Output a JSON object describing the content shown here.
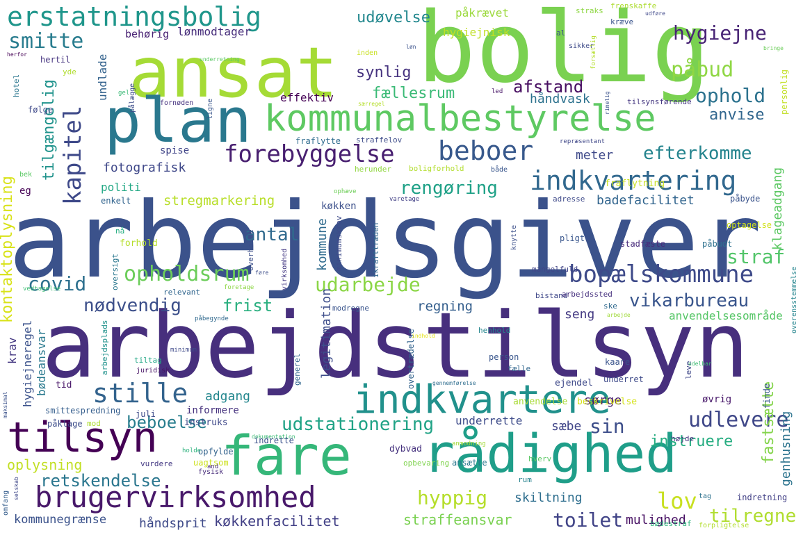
{
  "words": [
    {
      "text": "arbejdsgiver",
      "color": "#3b528b"
    },
    {
      "text": "arbejdstilsyn",
      "color": "#472f7d"
    },
    {
      "text": "bolig",
      "color": "#7ad151"
    },
    {
      "text": "ansat",
      "color": "#a5db36"
    },
    {
      "text": "plan",
      "color": "#2a788e"
    },
    {
      "text": "kommunalbestyrelse",
      "color": "#5ec962"
    },
    {
      "text": "fare",
      "color": "#35b779"
    },
    {
      "text": "rådighed",
      "color": "#1f9e89"
    },
    {
      "text": "tilsyn",
      "color": "#440154"
    },
    {
      "text": "indkvartere",
      "color": "#21918c"
    },
    {
      "text": "brugervirksomhed",
      "color": "#48186a"
    },
    {
      "text": "erstatningsbolig",
      "color": "#1f968b"
    },
    {
      "text": "indkvartering",
      "color": "#31688e"
    },
    {
      "text": "bopælskommune",
      "color": "#3e4a89"
    },
    {
      "text": "forebyggelse",
      "color": "#481f70"
    },
    {
      "text": "beboer",
      "color": "#38598c"
    },
    {
      "text": "stille",
      "color": "#33638d"
    },
    {
      "text": "smitte",
      "color": "#287c8e"
    },
    {
      "text": "kapitel",
      "color": "#3e4989"
    },
    {
      "text": "påbud",
      "color": "#8fd744"
    },
    {
      "text": "hygiejne",
      "color": "#482475"
    },
    {
      "text": "ophold",
      "color": "#2c728e"
    },
    {
      "text": "covid",
      "color": "#2d708e"
    },
    {
      "text": "opholdsrum",
      "color": "#6ccd5a"
    },
    {
      "text": "vikarbureau",
      "color": "#39558c"
    },
    {
      "text": "rengøring",
      "color": "#1fa187"
    },
    {
      "text": "efterkomme",
      "color": "#25848e"
    },
    {
      "text": "udarbejde",
      "color": "#8bd646"
    },
    {
      "text": "straf",
      "color": "#52c569"
    },
    {
      "text": "lov",
      "color": "#c8e020"
    },
    {
      "text": "hyppig",
      "color": "#b5de2b"
    },
    {
      "text": "retskendelse",
      "color": "#2a768e"
    },
    {
      "text": "udlevere",
      "color": "#3f4788"
    },
    {
      "text": "sin",
      "color": "#3d4e8a"
    },
    {
      "text": "toilet",
      "color": "#414487"
    },
    {
      "text": "udstationering",
      "color": "#20a386"
    },
    {
      "text": "beboelse",
      "color": "#287d8e"
    },
    {
      "text": "tilregne",
      "color": "#b0dd2f"
    },
    {
      "text": "frist",
      "color": "#29af7f"
    },
    {
      "text": "nødvendig",
      "color": "#3c4f8a"
    },
    {
      "text": "antal",
      "color": "#306a8e"
    },
    {
      "text": "afstand",
      "color": "#470e61"
    },
    {
      "text": "synlig",
      "color": "#46337f"
    },
    {
      "text": "udøvelse",
      "color": "#23888e"
    },
    {
      "text": "fællesrum",
      "color": "#3aba76"
    },
    {
      "text": "anvise",
      "color": "#31668e"
    },
    {
      "text": "tilgængelig",
      "color": "#20938c"
    },
    {
      "text": "kontaktoplysning",
      "color": "#d8e219"
    },
    {
      "text": "oplysning",
      "color": "#c2df23"
    },
    {
      "text": "kommunegrænse",
      "color": "#3b528b"
    },
    {
      "text": "håndsprit",
      "color": "#3e4a89"
    },
    {
      "text": "køkkenfacilitet",
      "color": "#424086"
    },
    {
      "text": "straffeansvar",
      "color": "#7ad151"
    },
    {
      "text": "mulighed",
      "color": "#471063"
    },
    {
      "text": "skiltning",
      "color": "#2e6e8e"
    },
    {
      "text": "instruere",
      "color": "#26ad81"
    },
    {
      "text": "fastsætte",
      "color": "#84d44b"
    },
    {
      "text": "genhusning",
      "color": "#2c738e"
    },
    {
      "text": "anvendelsesområde",
      "color": "#56c667"
    },
    {
      "text": "seng",
      "color": "#443a83"
    },
    {
      "text": "regning",
      "color": "#355f8d"
    },
    {
      "text": "legitimation",
      "color": "#3d4d8a"
    },
    {
      "text": "kommune",
      "color": "#2f6b8e"
    },
    {
      "text": "adgang",
      "color": "#24878e"
    },
    {
      "text": "sørge",
      "color": "#481b6d"
    },
    {
      "text": "underrette",
      "color": "#3e4c8a"
    },
    {
      "text": "sæbe",
      "color": "#404588"
    },
    {
      "text": "stregmarkering",
      "color": "#b8de29"
    },
    {
      "text": "fotografisk",
      "color": "#3f4889"
    },
    {
      "text": "politi",
      "color": "#22a884"
    },
    {
      "text": "køkken",
      "color": "#3c508b"
    },
    {
      "text": "meter",
      "color": "#3e4989"
    },
    {
      "text": "badefacilitet",
      "color": "#32658e"
    },
    {
      "text": "klageadgang",
      "color": "#5cc863"
    },
    {
      "text": "håndvask",
      "color": "#2c728e"
    },
    {
      "text": "effektiv",
      "color": "#440154"
    },
    {
      "text": "spise",
      "color": "#404588"
    },
    {
      "text": "lønmodtager",
      "color": "#472d7b"
    },
    {
      "text": "behørig",
      "color": "#482173"
    },
    {
      "text": "påkrævet",
      "color": "#9bd93c"
    },
    {
      "text": "hygiejnisk",
      "color": "#c0df25"
    },
    {
      "text": "undlade",
      "color": "#33628d"
    },
    {
      "text": "krav",
      "color": "#453882"
    },
    {
      "text": "hygiejneregel",
      "color": "#3b528b"
    },
    {
      "text": "bødeansvar",
      "color": "#29798e"
    },
    {
      "text": "informere",
      "color": "#46327e"
    },
    {
      "text": "instruks",
      "color": "#3f4889"
    },
    {
      "text": "smittespredning",
      "color": "#355e8d"
    },
    {
      "text": "påklage",
      "color": "#3d4d8a"
    },
    {
      "text": "tid",
      "color": "#481668"
    },
    {
      "text": "generel",
      "color": "#31668e"
    },
    {
      "text": "indrette",
      "color": "#3b518b"
    },
    {
      "text": "opfylde",
      "color": "#33638d"
    },
    {
      "text": "dybvad",
      "color": "#46327e"
    },
    {
      "text": "ansætte",
      "color": "#2a788e"
    },
    {
      "text": "opbevaring",
      "color": "#7fd34e"
    },
    {
      "text": "anvendelse",
      "color": "#a8db34"
    },
    {
      "text": "beskrivelse",
      "color": "#d5e21a"
    },
    {
      "text": "øvrig",
      "color": "#48186a"
    },
    {
      "text": "ejendel",
      "color": "#3e4989"
    },
    {
      "text": "underret",
      "color": "#3e4a89"
    },
    {
      "text": "person",
      "color": "#39568c"
    },
    {
      "text": "fælle",
      "color": "#31678e"
    },
    {
      "text": "henhold",
      "color": "#24868e"
    },
    {
      "text": "kaare",
      "color": "#3a548c"
    },
    {
      "text": "ske",
      "color": "#30698e"
    },
    {
      "text": "leve",
      "color": "#3f4788"
    },
    {
      "text": "juli",
      "color": "#3e4c8a"
    },
    {
      "text": "finde",
      "color": "#38588c"
    },
    {
      "text": "højde",
      "color": "#46317e"
    },
    {
      "text": "hverv",
      "color": "#5ac864"
    },
    {
      "text": "rum",
      "color": "#26828e"
    },
    {
      "text": "tag",
      "color": "#2d718e"
    },
    {
      "text": "indretning",
      "color": "#424086"
    },
    {
      "text": "bødestraf",
      "color": "#2eb37c"
    },
    {
      "text": "forpligtelse",
      "color": "#b2dd2d"
    },
    {
      "text": "vurdere",
      "color": "#443983"
    },
    {
      "text": "uagtsom",
      "color": "#cde11d"
    },
    {
      "text": "fysisk",
      "color": "#472c7a"
    },
    {
      "text": "and",
      "color": "#482878"
    },
    {
      "text": "holde",
      "color": "#2db27d"
    },
    {
      "text": "dokumentation",
      "color": "#3bbb75"
    },
    {
      "text": "anmodning",
      "color": "#a2da37"
    },
    {
      "text": "overtrædelse",
      "color": "#33638d"
    },
    {
      "text": "mod",
      "color": "#addc30"
    },
    {
      "text": "maksimal",
      "color": "#3b528b"
    },
    {
      "text": "omfang",
      "color": "#355e8d"
    },
    {
      "text": "selskab",
      "color": "#3f4889"
    },
    {
      "text": "tiltag",
      "color": "#22a785"
    },
    {
      "text": "juridisk",
      "color": "#471365"
    },
    {
      "text": "arbejdsplads",
      "color": "#20928c"
    },
    {
      "text": "minimum",
      "color": "#3e4989"
    },
    {
      "text": "modregne",
      "color": "#3a548c"
    },
    {
      "text": "påbegynde",
      "color": "#30698e"
    },
    {
      "text": "arbejde",
      "color": "#a0da39"
    },
    {
      "text": "indhold",
      "color": "#e5e419"
    },
    {
      "text": "overensstemmelse",
      "color": "#25858e"
    },
    {
      "text": "udelbar",
      "color": "#3fbc73"
    },
    {
      "text": "gennemførelse",
      "color": "#2e6d8e"
    },
    {
      "text": "relevant",
      "color": "#31668e"
    },
    {
      "text": "foretage",
      "color": "#8ed645"
    },
    {
      "text": "bistand",
      "color": "#3f4889"
    },
    {
      "text": "arbejdssted",
      "color": "#46307e"
    },
    {
      "text": "oversigt",
      "color": "#2a778e"
    },
    {
      "text": "mangelfuld",
      "color": "#414487"
    },
    {
      "text": "vedtagelse",
      "color": "#3dbc74"
    },
    {
      "text": "virksomhed",
      "color": "#443983"
    },
    {
      "text": "føre",
      "color": "#3d4e8a"
    },
    {
      "text": "forhold",
      "color": "#b5de2b"
    },
    {
      "text": "nå",
      "color": "#26ad81"
    },
    {
      "text": "overholde",
      "color": "#3c4f8a"
    },
    {
      "text": "ikrafttræden",
      "color": "#31668e"
    },
    {
      "text": "minimumskrav",
      "color": "#3e4a89"
    },
    {
      "text": "pligt",
      "color": "#39568c"
    },
    {
      "text": "påbudt",
      "color": "#2d708e"
    },
    {
      "text": "stadfæste",
      "color": "#472a7a"
    },
    {
      "text": "knytte",
      "color": "#3c4f8a"
    },
    {
      "text": "optagelse",
      "color": "#d0e11c"
    },
    {
      "text": "påbyde",
      "color": "#3a538b"
    },
    {
      "text": "adresse",
      "color": "#3e4989"
    },
    {
      "text": "varetage",
      "color": "#424086"
    },
    {
      "text": "ophæve",
      "color": "#6ece58"
    },
    {
      "text": "enkelt",
      "color": "#32648e"
    },
    {
      "text": "eg",
      "color": "#440154"
    },
    {
      "text": "bek",
      "color": "#5ac864"
    },
    {
      "text": "herunder",
      "color": "#92d742"
    },
    {
      "text": "boligforhold",
      "color": "#b2dd2d"
    },
    {
      "text": "både",
      "color": "#39568c"
    },
    {
      "text": "fraflytning",
      "color": "#c8e020"
    },
    {
      "text": "fraflytte",
      "color": "#2f6c8e"
    },
    {
      "text": "straffelov",
      "color": "#3e4c8a"
    },
    {
      "text": "repræsentant",
      "color": "#3f4788"
    },
    {
      "text": "ligne",
      "color": "#39568c"
    },
    {
      "text": "fornøden",
      "color": "#46337f"
    },
    {
      "text": "tilsynsførende",
      "color": "#453781"
    },
    {
      "text": "rimelig",
      "color": "#3b528b"
    },
    {
      "text": "led",
      "color": "#481668"
    },
    {
      "text": "særregel",
      "color": "#b5de2b"
    },
    {
      "text": "gel",
      "color": "#3aba76"
    },
    {
      "text": "pålægge",
      "color": "#3d4d8a"
    },
    {
      "text": "følge",
      "color": "#3e4989"
    },
    {
      "text": "yde",
      "color": "#b0dd2f"
    },
    {
      "text": "hotel",
      "color": "#2a768e"
    },
    {
      "text": "hertil",
      "color": "#463480"
    },
    {
      "text": "herfor",
      "color": "#440154"
    },
    {
      "text": "underretning",
      "color": "#5ac864"
    },
    {
      "text": "inden",
      "color": "#c8e020"
    },
    {
      "text": "løn",
      "color": "#3b528b"
    },
    {
      "text": "sikker",
      "color": "#3e4a89"
    },
    {
      "text": "forsætlig",
      "color": "#b5de2b"
    },
    {
      "text": "frenskaffe",
      "color": "#addc30"
    },
    {
      "text": "straks",
      "color": "#8fd744"
    },
    {
      "text": "kræve",
      "color": "#3a548c"
    },
    {
      "text": "udføre",
      "color": "#3f4889"
    },
    {
      "text": "bringe",
      "color": "#6ccd5a"
    },
    {
      "text": "al",
      "color": "#3b528b"
    },
    {
      "text": "personlig",
      "color": "#c2df23"
    }
  ]
}
